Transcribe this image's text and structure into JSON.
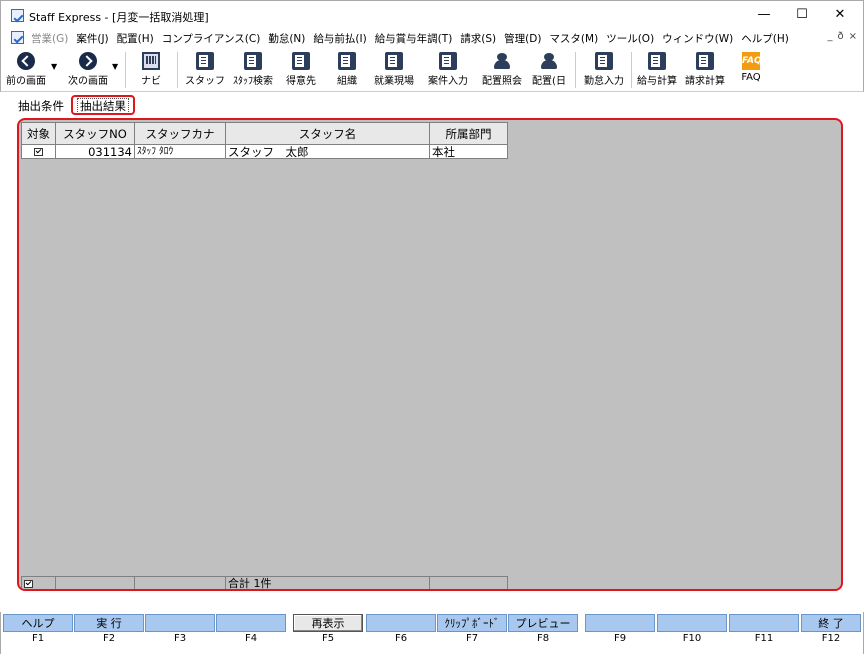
{
  "window": {
    "title": "Staff Express - [月変一括取消処理]",
    "minimize": "—",
    "maximize": "☐",
    "close": "✕"
  },
  "menu": {
    "items": [
      {
        "label": "営業(G)",
        "disabled": true
      },
      {
        "label": "案件(J)"
      },
      {
        "label": "配置(H)"
      },
      {
        "label": "コンプライアンス(C)"
      },
      {
        "label": "勤怠(N)"
      },
      {
        "label": "給与前払(I)"
      },
      {
        "label": "給与賞与年調(T)"
      },
      {
        "label": "請求(S)"
      },
      {
        "label": "管理(D)"
      },
      {
        "label": "マスタ(M)"
      },
      {
        "label": "ツール(O)"
      },
      {
        "label": "ウィンドウ(W)"
      },
      {
        "label": "ヘルプ(H)"
      }
    ],
    "mdi": [
      "_",
      "ð",
      "×"
    ]
  },
  "toolbar": {
    "prev": "前の画面",
    "next": "次の画面",
    "navi": "ナビ",
    "staff": "スタッフ",
    "staff_search": "ｽﾀｯﾌ検索",
    "customer": "得意先",
    "org": "組織",
    "workplace": "就業現場",
    "case_input": "案件入力",
    "assign_inquiry": "配置照会",
    "assign_day": "配置(日",
    "attendance_input": "勤怠入力",
    "salary_calc": "給与計算",
    "billing_calc": "請求計算",
    "faq": "FAQ",
    "faq_icon": "FAQ"
  },
  "tabs": {
    "conditions": "抽出条件",
    "results": "抽出結果"
  },
  "grid": {
    "headers": [
      "対象",
      "スタッフNO",
      "スタッフカナ",
      "スタッフ名",
      "所属部門"
    ],
    "rows": [
      {
        "checked": true,
        "staff_no": "031134",
        "kana": "ｽﾀｯﾌ ﾀﾛｳ",
        "name": "スタッフ　太郎",
        "dept": "本社"
      }
    ],
    "footer": {
      "checked": true,
      "summary": "合計 1件"
    }
  },
  "fkeys": [
    {
      "key": "F1",
      "label": "ヘルプ"
    },
    {
      "key": "F2",
      "label": "実 行"
    },
    {
      "key": "F3",
      "label": ""
    },
    {
      "key": "F4",
      "label": ""
    },
    {
      "key": "F5",
      "label": "再表示"
    },
    {
      "key": "F6",
      "label": ""
    },
    {
      "key": "F7",
      "label": "ｸﾘｯﾌﾟﾎﾞｰﾄﾞ"
    },
    {
      "key": "F8",
      "label": "プレビュー"
    },
    {
      "key": "F9",
      "label": ""
    },
    {
      "key": "F10",
      "label": ""
    },
    {
      "key": "F11",
      "label": ""
    },
    {
      "key": "F12",
      "label": "終 了"
    }
  ]
}
